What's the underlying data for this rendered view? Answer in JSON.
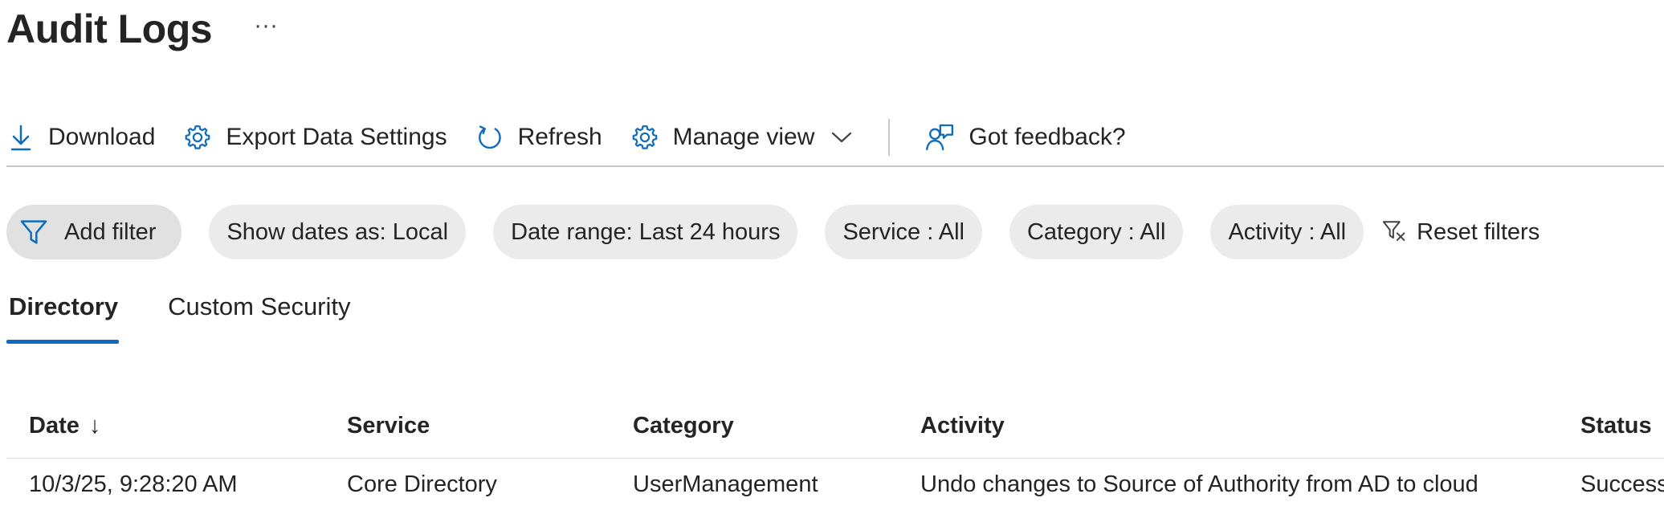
{
  "page": {
    "title": "Audit Logs",
    "more_label": "···"
  },
  "toolbar": {
    "download": "Download",
    "export_settings": "Export Data Settings",
    "refresh": "Refresh",
    "manage_view": "Manage view",
    "feedback": "Got feedback?"
  },
  "filters": {
    "add_filter": "Add filter",
    "show_dates": "Show dates as: Local",
    "date_range": "Date range: Last 24 hours",
    "service": "Service : All",
    "category": "Category : All",
    "activity": "Activity : All",
    "reset": "Reset filters"
  },
  "tabs": [
    {
      "label": "Directory",
      "active": true
    },
    {
      "label": "Custom Security",
      "active": false
    }
  ],
  "table": {
    "columns": {
      "date": "Date",
      "date_sort_indicator": "↓",
      "service": "Service",
      "category": "Category",
      "activity": "Activity",
      "status": "Status"
    },
    "rows": [
      {
        "date": "10/3/25, 9:28:20 AM",
        "service": "Core Directory",
        "category": "UserManagement",
        "activity": "Undo changes to Source of Authority from AD to cloud",
        "status": "Success"
      }
    ]
  },
  "colors": {
    "accent": "#0f6cbd",
    "text": "#242424",
    "pill_bg": "#ebebeb",
    "divider": "#c8c8c8"
  },
  "icons": {
    "download": "download-arrow-icon",
    "export": "gear-icon",
    "refresh": "refresh-icon",
    "manage_view": "gear-icon",
    "manage_view_chevron": "chevron-down-icon",
    "feedback": "person-feedback-icon",
    "add_filter": "funnel-icon",
    "reset": "funnel-clear-icon"
  }
}
